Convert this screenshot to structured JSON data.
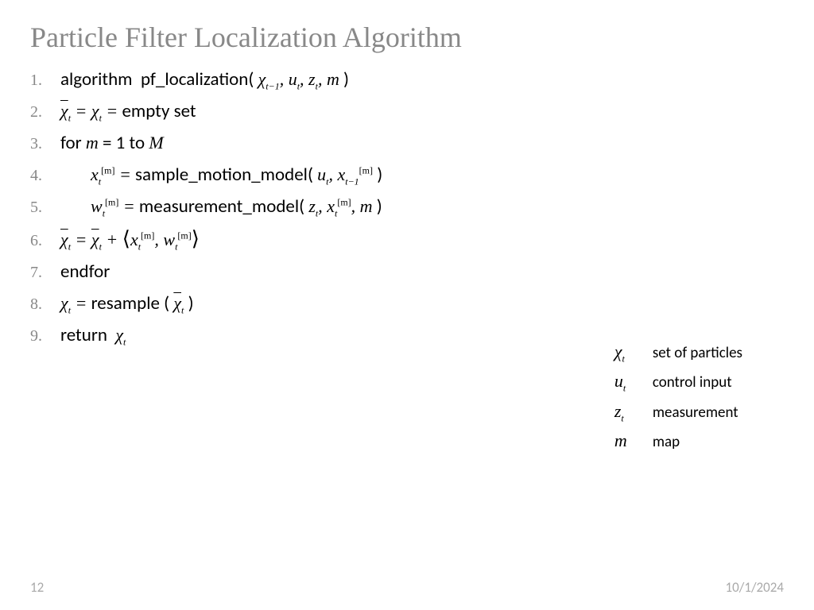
{
  "title": "Particle Filter Localization Algorithm",
  "lines": {
    "n1": "1.",
    "n2": "2.",
    "n3": "3.",
    "n4": "4.",
    "n5": "5.",
    "n6": "6.",
    "n7": "7.",
    "n8": "8.",
    "n9": "9."
  },
  "text": {
    "algorithm": "algorithm",
    "funcname": "pf_localization(",
    "close_paren": ")",
    "empty_set": "empty set",
    "for": "for",
    "eq1": "= 1",
    "to": "to",
    "M": "M",
    "sample": "sample_motion_model(",
    "measure": "measurement_model(",
    "endfor": "endfor",
    "resample": "resample (",
    "return": "return",
    "comma": ", ",
    "eq": " = ",
    "plus": " + "
  },
  "symbols": {
    "chi": "χ",
    "u": "u",
    "z": "z",
    "m": "m",
    "x": "x",
    "w": "w",
    "t": "t",
    "tm1": "t−1",
    "bracket_m": "[m]"
  },
  "legend": {
    "chi_desc": "set of particles",
    "u_desc": "control input",
    "z_desc": "measurement",
    "m_desc": "map"
  },
  "footer": {
    "page": "12",
    "date": "10/1/2024"
  }
}
